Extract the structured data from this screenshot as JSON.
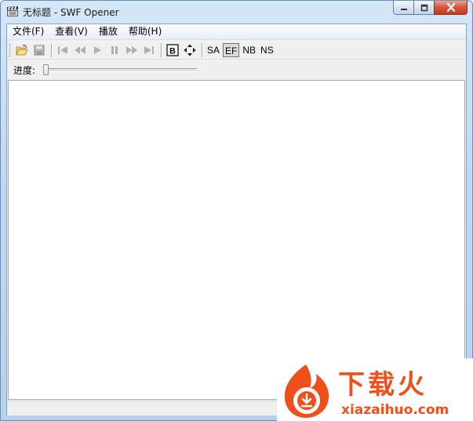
{
  "window": {
    "title": "无标题 - SWF Opener",
    "app_icon": "clapperboard-icon"
  },
  "title_controls": {
    "minimize_icon": "minimize-icon",
    "maximize_icon": "maximize-icon",
    "close_icon": "close-icon"
  },
  "menu": {
    "items": [
      {
        "label": "文件(F)"
      },
      {
        "label": "查看(V)"
      },
      {
        "label": "播放"
      },
      {
        "label": "帮助(H)"
      }
    ]
  },
  "toolbar": {
    "icons": [
      "open-folder-icon",
      "save-icon",
      "first-frame-icon",
      "rewind-icon",
      "play-icon",
      "pause-icon",
      "fast-forward-icon",
      "last-frame-icon",
      "border-box-icon",
      "move-arrows-icon"
    ],
    "text_buttons": [
      {
        "label": "SA",
        "pressed": false
      },
      {
        "label": "EF",
        "pressed": true
      },
      {
        "label": "NB",
        "pressed": false
      },
      {
        "label": "NS",
        "pressed": false
      }
    ],
    "border_button_label": "B"
  },
  "progress": {
    "label": "进度:",
    "value_fraction": 0.0
  },
  "status": {
    "text": ""
  },
  "watermark": {
    "brand": "下载火",
    "url": "xiazaihuo.com",
    "colors": {
      "primary": "#ef4f1a"
    }
  },
  "colors": {
    "titlebar": "#c3d9f1",
    "close_button": "#d5543a",
    "viewport": "#ffffff"
  }
}
